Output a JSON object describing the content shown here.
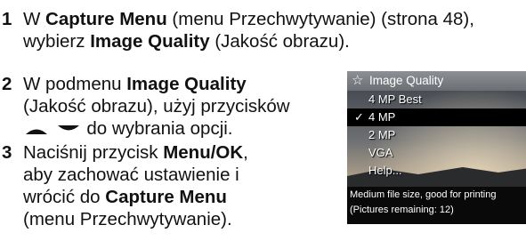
{
  "steps": [
    {
      "number": "1",
      "lines": [
        {
          "t1": "W ",
          "b1": "Capture Menu",
          "t2": " (menu Przechwytywanie) (strona 48),"
        },
        {
          "t1": "wybierz ",
          "b1": "Image Quality",
          "t2": " (Jakość obrazu)."
        }
      ]
    },
    {
      "number": "2",
      "lines": [
        {
          "t1": "W podmenu ",
          "b1": "Image Quality"
        },
        {
          "t1": "(Jakość obrazu), użyj przycisków"
        },
        {
          "t1": "do wybrania opcji."
        }
      ]
    },
    {
      "number": "3",
      "lines": [
        {
          "t1": "Naciśnij przycisk ",
          "b1": "Menu/OK",
          "t2": ","
        },
        {
          "t1": "aby zachować ustawienie i"
        },
        {
          "t1": "wrócić do ",
          "b1": "Capture Menu"
        },
        {
          "t1": "(menu Przechwytywanie)."
        }
      ]
    }
  ],
  "camera_screen": {
    "title": "Image Quality",
    "title_icon": "star-outline-icon",
    "options": [
      "4 MP Best",
      "4 MP",
      "2 MP",
      "VGA",
      "Help..."
    ],
    "selected_option": "4 MP",
    "check_mark": "✓",
    "description_line1": "Medium file size, good for printing",
    "description_line2": "(Pictures remaining: 12)"
  },
  "colors": {
    "arrow": "#111111",
    "selection_bar": "#000000",
    "title_bar": "#7d8084"
  }
}
